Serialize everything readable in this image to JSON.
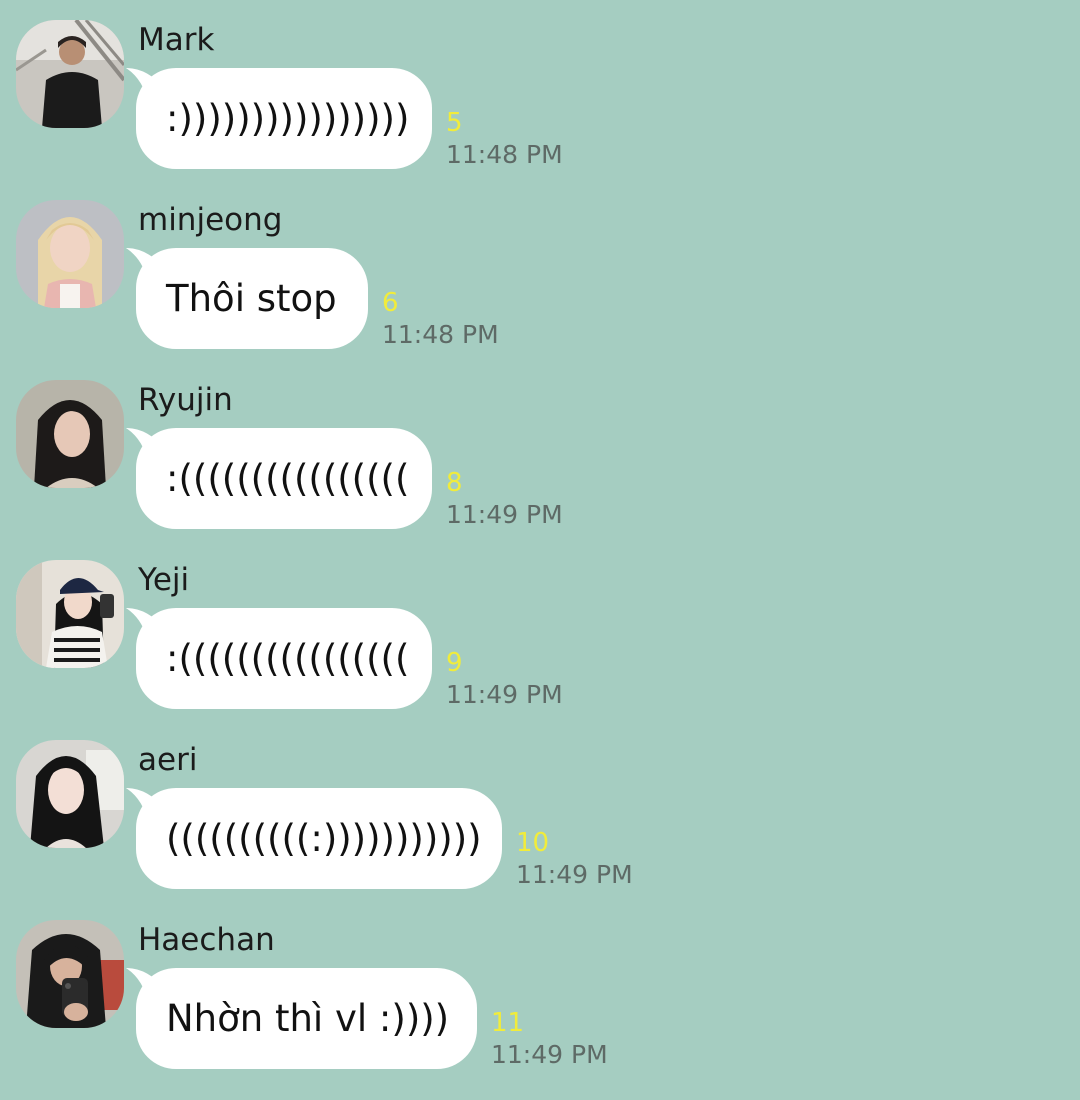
{
  "colors": {
    "background": "#a5cdc1",
    "bubble": "#ffffff",
    "unread_count": "#f1ec3b",
    "timestamp": "#5e6a66"
  },
  "messages": [
    {
      "sender": "Mark",
      "text": ":))))))))))))))))",
      "unread": "5",
      "time": "11:48 PM"
    },
    {
      "sender": "minjeong",
      "text": "Thôi stop",
      "unread": "6",
      "time": "11:48 PM"
    },
    {
      "sender": "Ryujin",
      "text": ":((((((((((((((((",
      "unread": "8",
      "time": "11:49 PM"
    },
    {
      "sender": "Yeji",
      "text": ":((((((((((((((((",
      "unread": "9",
      "time": "11:49 PM"
    },
    {
      "sender": "aeri",
      "text": "((((((((((:)))))))))))",
      "unread": "10",
      "time": "11:49 PM"
    },
    {
      "sender": "Haechan",
      "text": "Nhờn thì vl :))))",
      "unread": "11",
      "time": "11:49 PM"
    }
  ]
}
